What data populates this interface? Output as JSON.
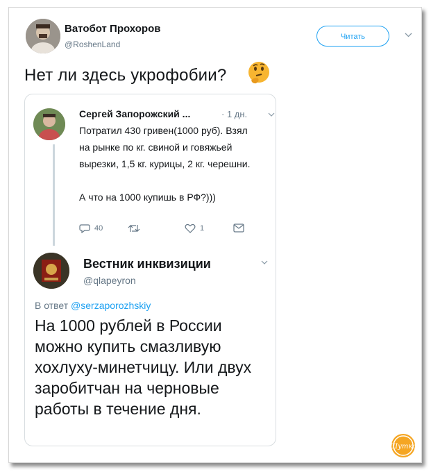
{
  "tweet": {
    "author_name": "Ватобот Прохоров",
    "author_handle": "@RoshenLand",
    "follow_label": "Читать",
    "text": "Нет ли здесь укрофобии?",
    "emoji_icon": "thinking-face-icon"
  },
  "quoted_first": {
    "author_name": "Сергей Запорожский ...",
    "time": "· 1 дн.",
    "text": "Потратил 430 гривен(1000 руб). Взял на рынке по кг. свиной и говяжьей вырезки, 1,5 кг. курицы, 2 кг. черешни.\n\nА что на 1000 купишь в РФ?)))",
    "actions": {
      "reply_count": "40",
      "retweet_count": "",
      "like_count": "1"
    }
  },
  "quoted_reply": {
    "author_name": "Вестник инквизиции",
    "author_handle": "@qlapeyron",
    "reply_prefix": "В ответ",
    "reply_mention": "@serzaporozhskiy",
    "text": "На 1000 рублей в России можно купить смазливую хохлуху-минетчицу. Или двух заробитчан на черновые работы в течение дня."
  },
  "watermark": {
    "text": "Шутка",
    "color": "#f5a623"
  },
  "colors": {
    "accent": "#1da1f2",
    "secondary_text": "#657786",
    "border": "#d8dde0"
  }
}
